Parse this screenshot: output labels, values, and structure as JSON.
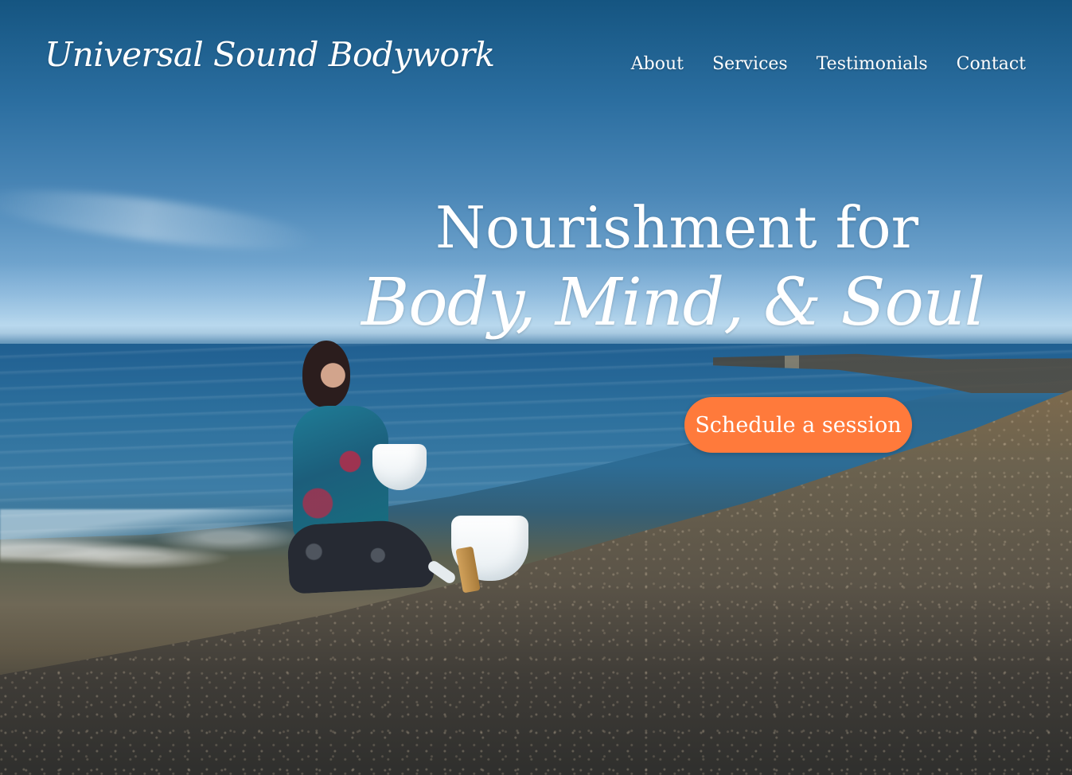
{
  "header": {
    "logo_text": "Universal Sound Bodywork",
    "nav": [
      {
        "label": "About"
      },
      {
        "label": "Services"
      },
      {
        "label": "Testimonials"
      },
      {
        "label": "Contact"
      }
    ]
  },
  "hero": {
    "headline": "Nourishment for",
    "subheadline": "Body, Mind, & Soul",
    "cta_label": "Schedule a session"
  },
  "colors": {
    "cta": "#ff7a3b",
    "text": "#ffffff"
  },
  "icons": {}
}
